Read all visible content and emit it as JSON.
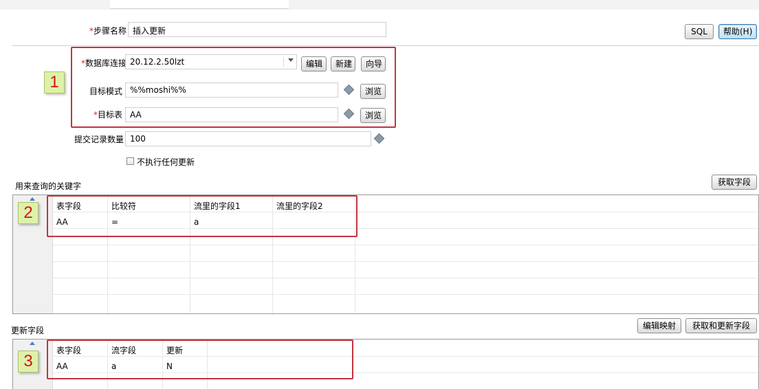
{
  "form": {
    "step_name": {
      "label": "步骤名称",
      "value": "插入更新"
    },
    "connection": {
      "label": "数据库连接",
      "value": "20.12.2.50lzt",
      "edit": "编辑",
      "new": "新建",
      "wizard": "向导"
    },
    "schema": {
      "label": "目标模式",
      "value": "%%moshi%%",
      "browse": "浏览"
    },
    "table": {
      "label": "目标表",
      "value": "AA",
      "browse": "浏览"
    },
    "commit_size": {
      "label": "提交记录数量",
      "value": "100"
    },
    "no_update": {
      "label": "不执行任何更新",
      "checked": false
    },
    "required_mark": "*"
  },
  "top_buttons": {
    "sql": "SQL",
    "help": "帮助(H)"
  },
  "key_section": {
    "title": "用来查询的关键字",
    "get_fields": "获取字段",
    "columns": [
      "表字段",
      "比较符",
      "流里的字段1",
      "流里的字段2"
    ],
    "rows": [
      [
        "AA",
        "=",
        "a",
        ""
      ]
    ]
  },
  "update_section": {
    "title": "更新字段",
    "edit_mapping": "编辑映射",
    "get_update_fields": "获取和更新字段",
    "columns": [
      "表字段",
      "流字段",
      "更新"
    ],
    "rows": [
      [
        "AA",
        "a",
        "N"
      ]
    ]
  },
  "annotations": [
    "1",
    "2",
    "3"
  ],
  "colors": {
    "highlight": "#c0343f",
    "tag_bg": "#dff1a8",
    "tag_text": "#d01515"
  }
}
